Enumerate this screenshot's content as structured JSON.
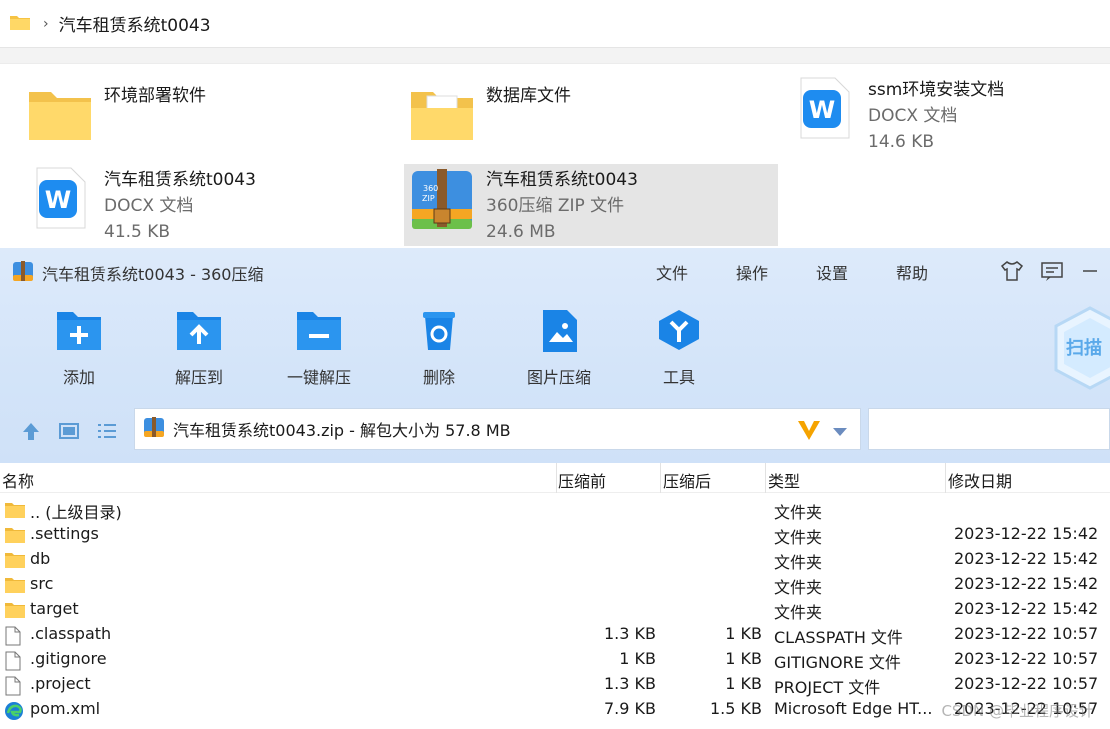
{
  "explorer": {
    "breadcrumb": "汽车租赁系统t0043",
    "files": [
      {
        "name": "环境部署软件",
        "sub1": "",
        "sub2": "",
        "icon": "folder-icon"
      },
      {
        "name": "数据库文件",
        "sub1": "",
        "sub2": "",
        "icon": "folder-with-document-icon"
      },
      {
        "name": "ssm环境安装文档",
        "sub1": "DOCX 文档",
        "sub2": "14.6 KB",
        "icon": "word-document-icon"
      },
      {
        "name": "汽车租赁系统t0043",
        "sub1": "DOCX 文档",
        "sub2": "41.5 KB",
        "icon": "word-document-icon"
      },
      {
        "name": "汽车租赁系统t0043",
        "sub1": "360压缩 ZIP 文件",
        "sub2": "24.6 MB",
        "icon": "zip-archive-icon",
        "selected": true
      }
    ]
  },
  "zip": {
    "title": "汽车租赁系统t0043 - 360压缩",
    "menu": [
      "文件",
      "操作",
      "设置",
      "帮助"
    ],
    "tools": [
      {
        "label": "添加",
        "icon": "add-icon"
      },
      {
        "label": "解压到",
        "icon": "extract-to-icon"
      },
      {
        "label": "一键解压",
        "icon": "one-click-extract-icon"
      },
      {
        "label": "删除",
        "icon": "delete-icon"
      },
      {
        "label": "图片压缩",
        "icon": "image-compress-icon"
      },
      {
        "label": "工具",
        "icon": "tools-icon"
      }
    ],
    "scan_label": "扫描",
    "path": "汽车租赁系统t0043.zip - 解包大小为 57.8 MB",
    "columns": {
      "name": "名称",
      "size": "压缩前",
      "packed": "压缩后",
      "type": "类型",
      "date": "修改日期"
    },
    "rows": [
      {
        "name": ".. (上级目录)",
        "size": "",
        "packed": "",
        "type": "文件夹",
        "date": "",
        "icon": "folder-icon"
      },
      {
        "name": ".settings",
        "size": "",
        "packed": "",
        "type": "文件夹",
        "date": "2023-12-22 15:42",
        "icon": "folder-icon"
      },
      {
        "name": "db",
        "size": "",
        "packed": "",
        "type": "文件夹",
        "date": "2023-12-22 15:42",
        "icon": "folder-icon"
      },
      {
        "name": "src",
        "size": "",
        "packed": "",
        "type": "文件夹",
        "date": "2023-12-22 15:42",
        "icon": "folder-icon"
      },
      {
        "name": "target",
        "size": "",
        "packed": "",
        "type": "文件夹",
        "date": "2023-12-22 15:42",
        "icon": "folder-icon"
      },
      {
        "name": ".classpath",
        "size": "1.3 KB",
        "packed": "1 KB",
        "type": "CLASSPATH 文件",
        "date": "2023-12-22 10:57",
        "icon": "file-icon"
      },
      {
        "name": ".gitignore",
        "size": "1 KB",
        "packed": "1 KB",
        "type": "GITIGNORE 文件",
        "date": "2023-12-22 10:57",
        "icon": "file-icon"
      },
      {
        "name": ".project",
        "size": "1.3 KB",
        "packed": "1 KB",
        "type": "PROJECT 文件",
        "date": "2023-12-22 10:57",
        "icon": "file-icon"
      },
      {
        "name": "pom.xml",
        "size": "7.9 KB",
        "packed": "1.5 KB",
        "type": "Microsoft Edge HT...",
        "date": "2023-12-22 10:57",
        "icon": "edge-icon"
      }
    ],
    "watermark": "CSDN @毕业程序设计"
  }
}
